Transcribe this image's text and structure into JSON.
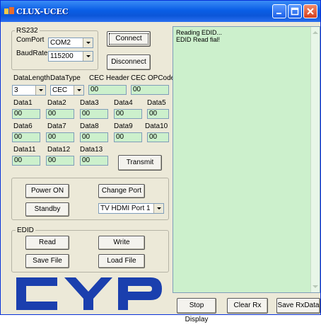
{
  "window": {
    "title": "CLUX-UCEC",
    "accent": "#0a5ee6",
    "rx_background": "#ccf0cc"
  },
  "rs232": {
    "group_label": "RS232",
    "comport_label": "ComPort",
    "comport_value": "COM2",
    "baudrate_label": "BaudRate",
    "baudrate_value": "115200",
    "connect_label": "Connect",
    "disconnect_label": "Disconnect"
  },
  "cec": {
    "datalength_label": "DataLength",
    "datalength_value": "3",
    "datatype_label": "DataType",
    "datatype_value": "CEC",
    "header_label": "CEC Header",
    "header_value": "00",
    "opcode_label": "CEC OPCode",
    "opcode_value": "00",
    "data": [
      {
        "label": "Data1",
        "value": "00"
      },
      {
        "label": "Data2",
        "value": "00"
      },
      {
        "label": "Data3",
        "value": "00"
      },
      {
        "label": "Data4",
        "value": "00"
      },
      {
        "label": "Data5",
        "value": "00"
      },
      {
        "label": "Data6",
        "value": "00"
      },
      {
        "label": "Data7",
        "value": "00"
      },
      {
        "label": "Data8",
        "value": "00"
      },
      {
        "label": "Data9",
        "value": "00"
      },
      {
        "label": "Data10",
        "value": "00"
      },
      {
        "label": "Data11",
        "value": "00"
      },
      {
        "label": "Data12",
        "value": "00"
      },
      {
        "label": "Data13",
        "value": "00"
      }
    ],
    "transmit_label": "Transmit"
  },
  "controls": {
    "power_on_label": "Power ON",
    "change_port_label": "Change Port",
    "standby_label": "Standby",
    "port_value": "TV HDMI Port 1"
  },
  "edid": {
    "group_label": "EDID",
    "read_label": "Read",
    "write_label": "Write",
    "save_file_label": "Save File",
    "load_file_label": "Load File"
  },
  "rx": {
    "lines": [
      "Reading EDID...",
      "EDID Read fial!"
    ],
    "stop_display_label": "Stop Display",
    "clear_rx_label": "Clear Rx",
    "save_rxdata_label": "Save RxData"
  },
  "logo": {
    "text": "CYP",
    "color": "#1a3fae"
  },
  "icons": [
    "app-icon",
    "minimize-icon",
    "maximize-icon",
    "close-icon",
    "chevron-down-icon",
    "scroll-up-icon",
    "scroll-down-icon"
  ]
}
